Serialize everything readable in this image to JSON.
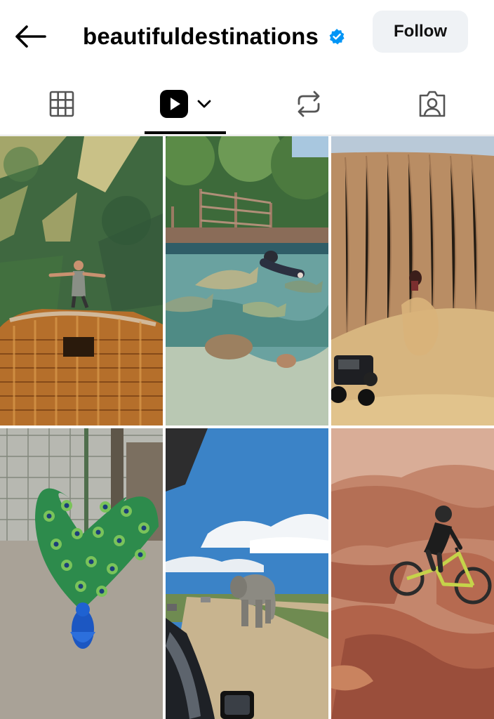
{
  "header": {
    "username": "beautifuldestinations",
    "verified": true,
    "follow_label": "Follow",
    "back_icon": "arrow-left-icon",
    "verified_icon": "verified-badge-icon",
    "accent_color": "#0095f6"
  },
  "tabs": [
    {
      "name": "posts",
      "icon": "grid-icon",
      "selected": false
    },
    {
      "name": "reels",
      "icon": "reels-icon",
      "selected": true,
      "has_dropdown": true
    },
    {
      "name": "reposts",
      "icon": "repost-icon",
      "selected": false
    },
    {
      "name": "tagged",
      "icon": "tagged-person-icon",
      "selected": false
    }
  ],
  "grid": {
    "items": [
      {
        "subject": "hot air balloon basket and person in harness above forest"
      },
      {
        "subject": "person swimming with fish and stingrays beside a wooden deck"
      },
      {
        "subject": "jeep at the base of a huge sand dune with a person sliding down"
      },
      {
        "subject": "peacock with its tail fanned"
      },
      {
        "subject": "elephant walking along a dirt road seen from a car"
      },
      {
        "subject": "mountain biker jumping in a red rock canyon"
      }
    ]
  }
}
